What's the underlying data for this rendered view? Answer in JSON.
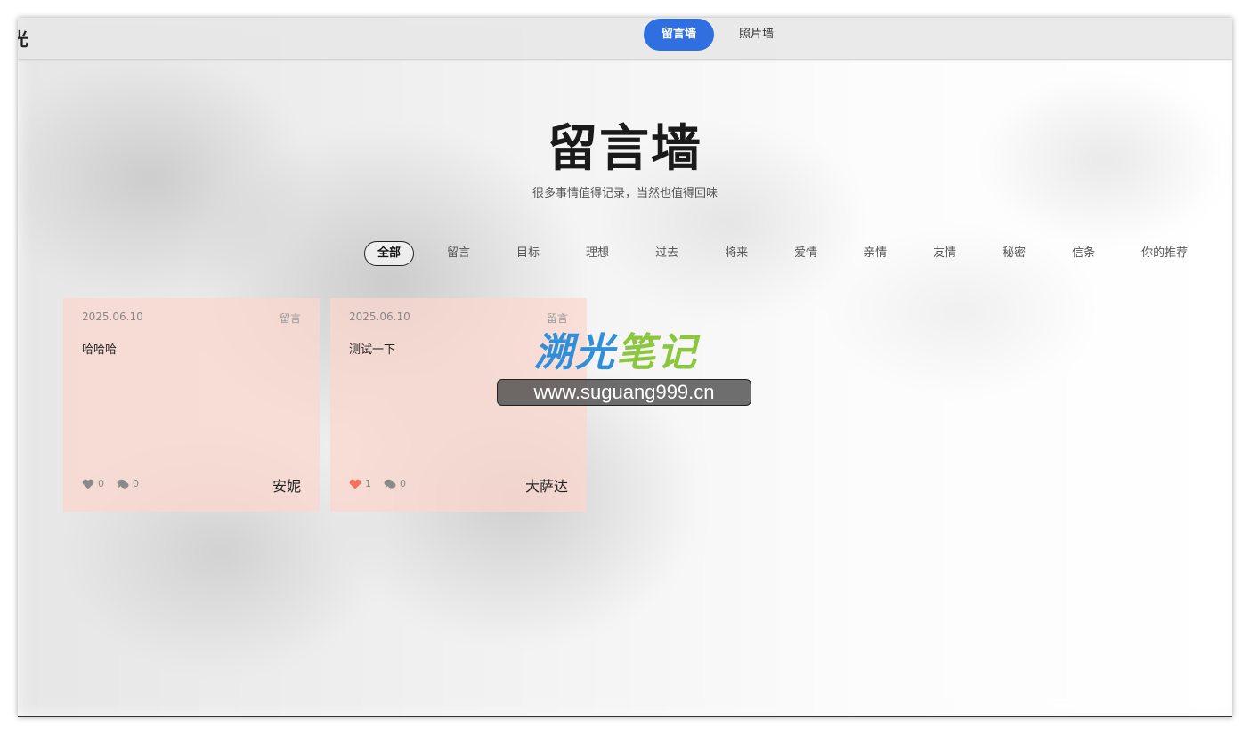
{
  "header": {
    "logo_text": "光",
    "nav": [
      {
        "label": "留言墙",
        "active": true
      },
      {
        "label": "照片墙",
        "active": false
      }
    ]
  },
  "hero": {
    "title": "留言墙",
    "subtitle": "很多事情值得记录，当然也值得回味"
  },
  "tabs": [
    {
      "label": "全部",
      "active": true
    },
    {
      "label": "留言"
    },
    {
      "label": "目标"
    },
    {
      "label": "理想"
    },
    {
      "label": "过去"
    },
    {
      "label": "将来"
    },
    {
      "label": "爱情"
    },
    {
      "label": "亲情"
    },
    {
      "label": "友情"
    },
    {
      "label": "秘密"
    },
    {
      "label": "信条"
    },
    {
      "label": "你的推荐"
    }
  ],
  "cards": [
    {
      "date": "2025.06.10",
      "category": "留言",
      "content": "哈哈哈",
      "likes": "0",
      "comments": "0",
      "author": "安妮",
      "liked": false
    },
    {
      "date": "2025.06.10",
      "category": "留言",
      "content": "测试一下",
      "likes": "1",
      "comments": "0",
      "author": "大萨达",
      "liked": true
    }
  ],
  "watermark": {
    "brand_a": "溯光",
    "brand_b": "笔记",
    "url": "www.suguang999.cn"
  },
  "colors": {
    "accent": "#2f6fe0",
    "like_active": "#f0735a",
    "like_inactive": "#8a8a8a",
    "card_bg": "#fcd7cd",
    "brand_blue": "#2f8fd8",
    "brand_green": "#8cc63f"
  }
}
